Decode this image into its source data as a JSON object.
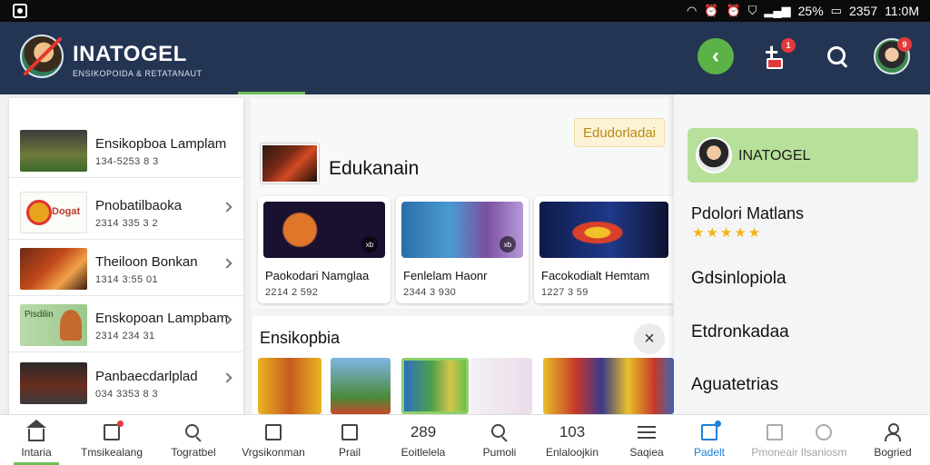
{
  "statusbar": {
    "battery_pct": "25%",
    "time": "11:0M",
    "misc": "2357"
  },
  "header": {
    "brand_name": "INATOGEL",
    "brand_tagline": "ENSIKOPOIDA & RETATANAUT",
    "add_badge": "1",
    "avatar_badge": "9"
  },
  "left_list": {
    "items": [
      {
        "title": "Ensikopboa Lamplam",
        "sub": "134-5253 8 3",
        "has_chevron": false
      },
      {
        "title": "Pnobatilbaoka",
        "sub": "2314 335 3 2",
        "has_chevron": true,
        "thumb_text": "Dogat"
      },
      {
        "title": "Theiloon Bonkan",
        "sub": "1314 3:55 01",
        "has_chevron": true
      },
      {
        "title": "Enskopoan Lampbam",
        "sub": "2314 234 31",
        "has_chevron": true,
        "thumb_text": "Pisdilin"
      },
      {
        "title": "Panbaecdarlplad",
        "sub": "034 3353 8 3",
        "has_chevron": true
      }
    ]
  },
  "middle": {
    "pill_label": "Edudorladai",
    "section_title": "Edukanain",
    "games": [
      {
        "title": "Paokodari Namglaa",
        "sub": "2214 2 592",
        "badge": "xb"
      },
      {
        "title": "Fenlelam Haonr",
        "sub": "2344 3 930",
        "badge": "xb"
      },
      {
        "title": "Facokodialt Hemtam",
        "sub": "1227 3 59",
        "badge": ""
      }
    ],
    "encyclopedia_title": "Ensikopbia",
    "close_icon": "×"
  },
  "drawer": {
    "user_name": "INATOGEL",
    "rating_label": "Pdolori Matlans",
    "stars": "★★★★★",
    "items": [
      "Gdsinlopiola",
      "Etdronkadaa",
      "Aguatetrias"
    ]
  },
  "bottom_nav": {
    "items": [
      {
        "label": "Intaria",
        "icon": "home-icon"
      },
      {
        "label": "Tmsikealang",
        "icon": "notes-icon"
      },
      {
        "label": "Togratbel",
        "icon": "search-icon"
      },
      {
        "label": "Vrgsikonman",
        "icon": "chat-icon"
      },
      {
        "label": "Prail",
        "icon": "book-icon"
      },
      {
        "label": "Eoitlelela",
        "number": "289"
      },
      {
        "label": "Pumoli",
        "icon": "search-icon"
      },
      {
        "label": "Enlaloojkin",
        "number": "103"
      },
      {
        "label": "Saqiea",
        "icon": "menu-icon"
      },
      {
        "label": "Padelt",
        "icon": "calendar-icon"
      },
      {
        "label": "Pmoneair",
        "icon": "library-icon"
      },
      {
        "label": "Ilsaniosm",
        "icon": "camera-icon"
      },
      {
        "label": "Bogried",
        "icon": "person-icon"
      }
    ]
  },
  "colors": {
    "header_bg": "#243453",
    "accent_green": "#5bb246",
    "badge_red": "#e23a3a",
    "active_blue": "#1f7fd6"
  }
}
